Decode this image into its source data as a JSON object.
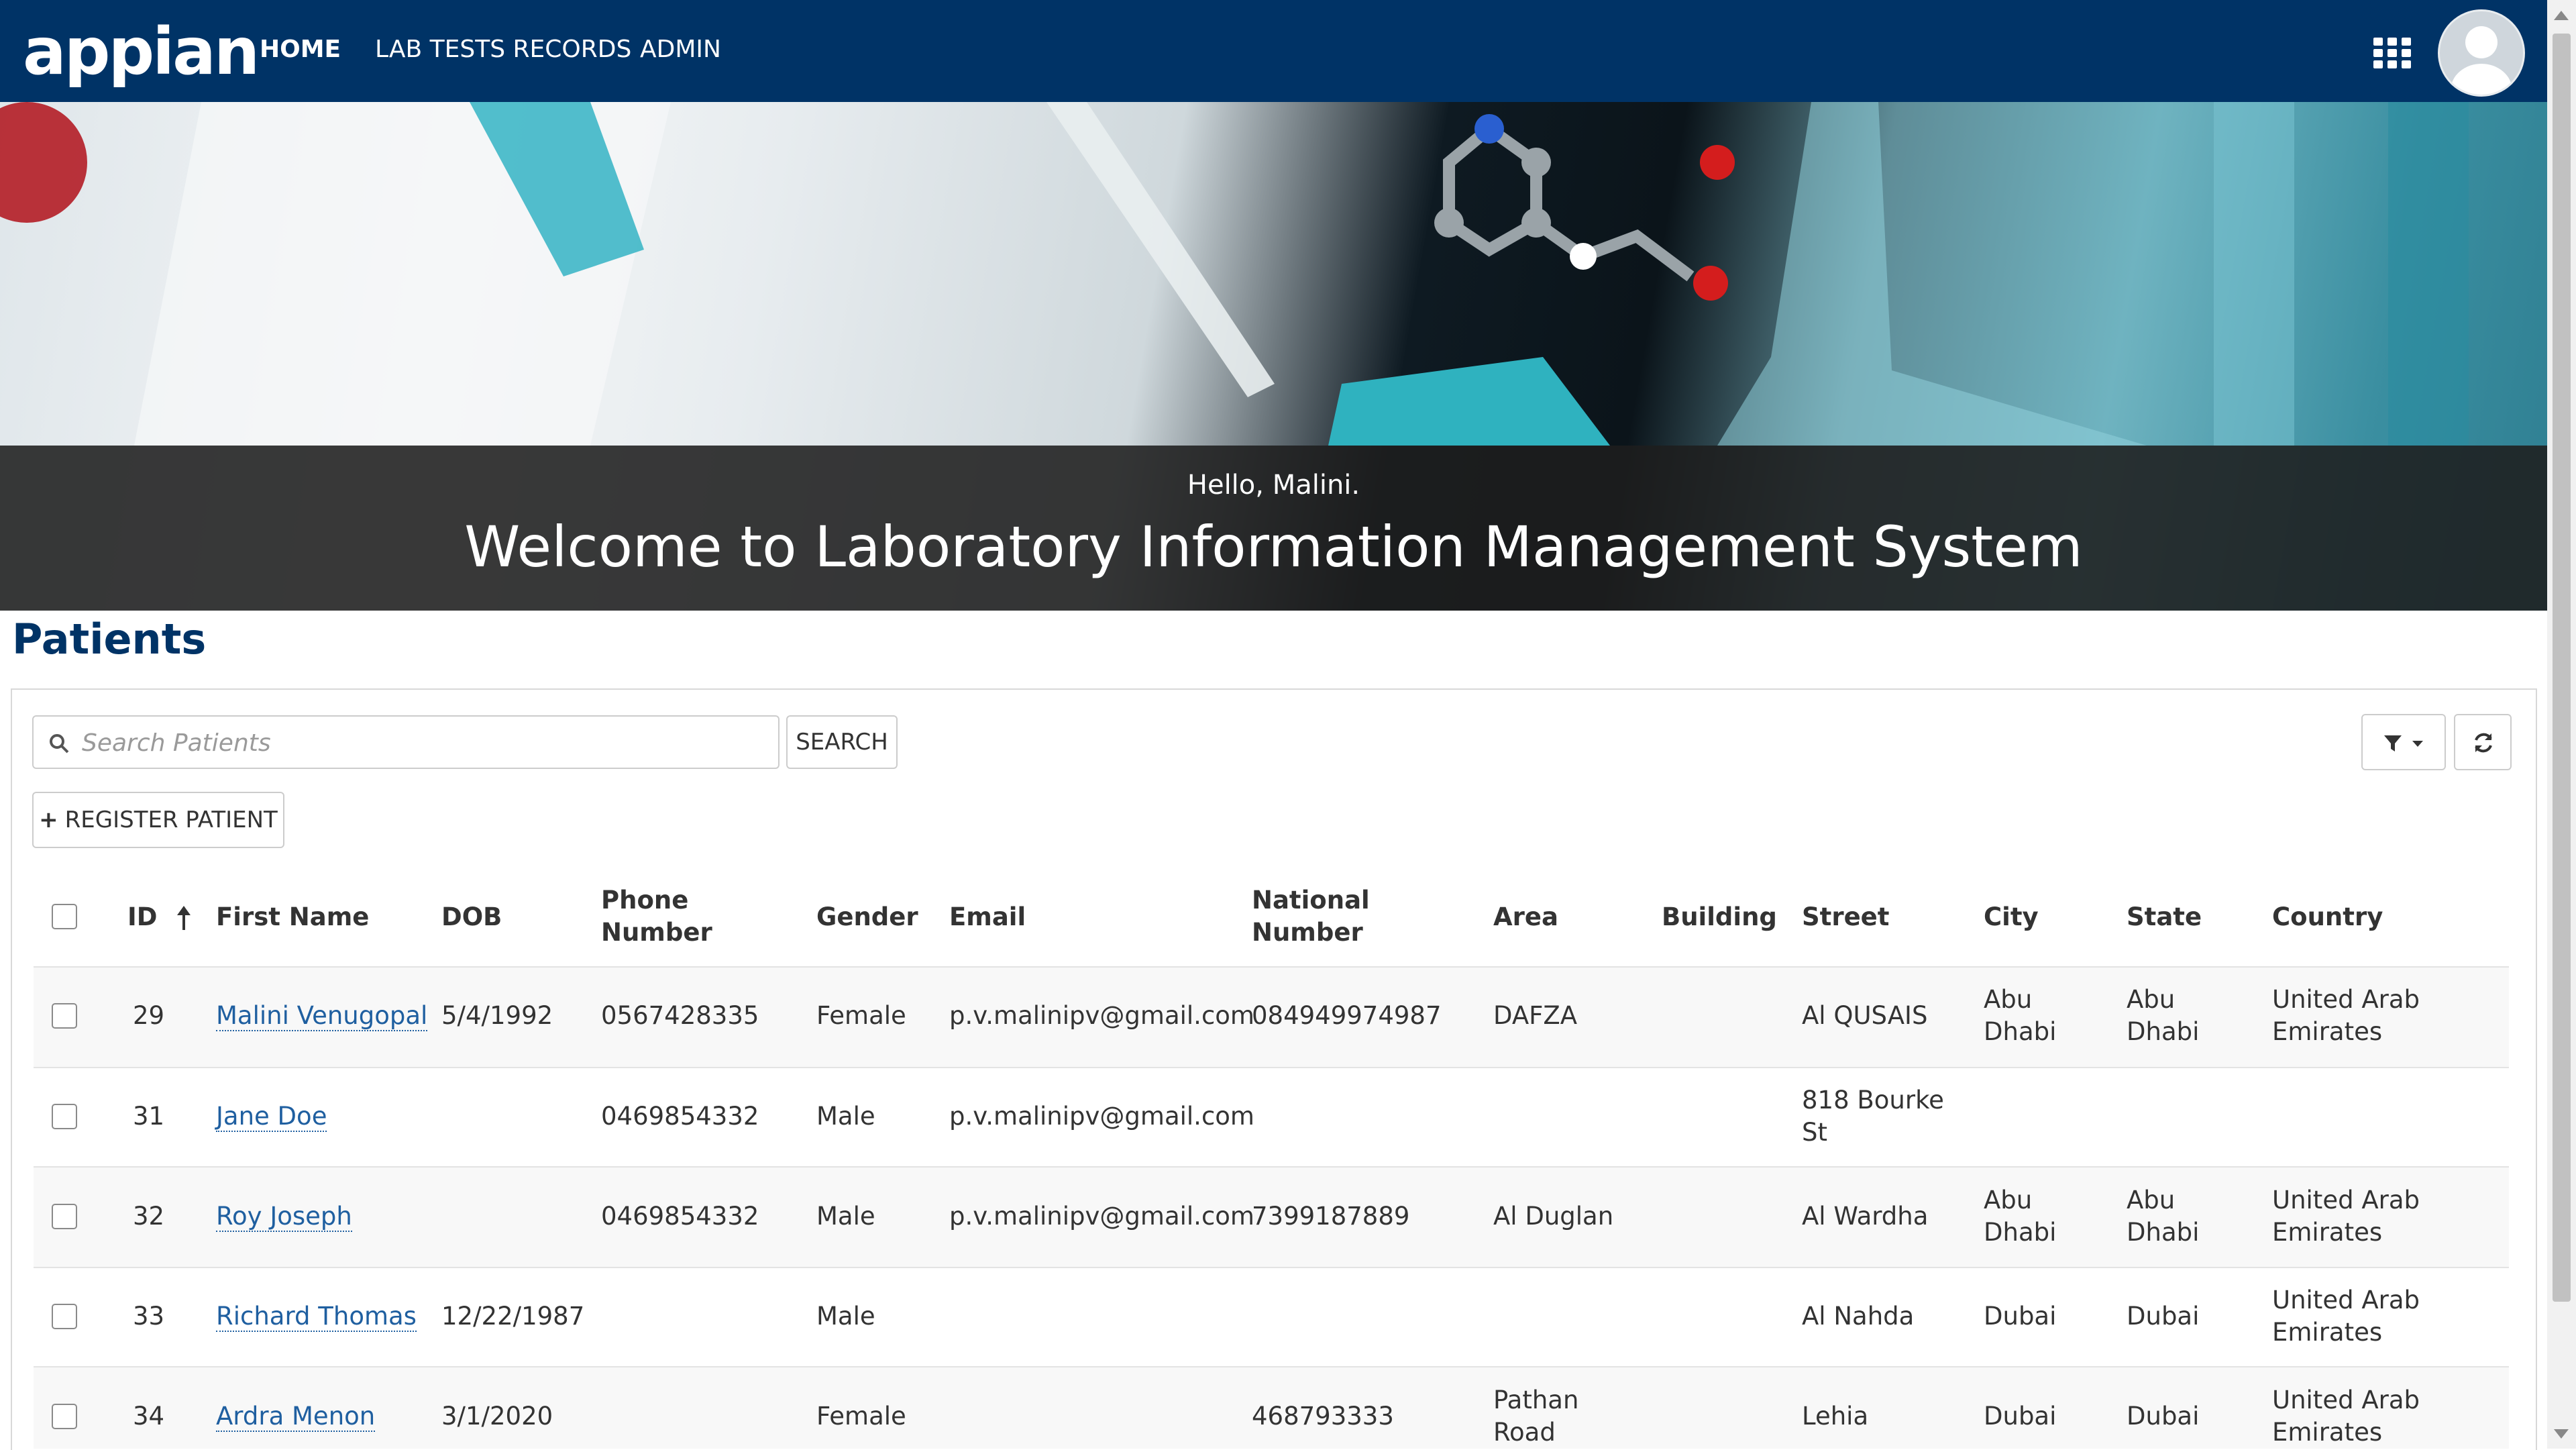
{
  "app": {
    "logo_text": "appian"
  },
  "nav": {
    "items": [
      {
        "label": "HOME",
        "active": true
      },
      {
        "label": "LAB TESTS RECORDS"
      },
      {
        "label": "ADMIN"
      }
    ]
  },
  "banner": {
    "hello": "Hello, Malini.",
    "welcome": "Welcome to Laboratory Information Management System"
  },
  "section": {
    "title": "Patients"
  },
  "search": {
    "placeholder": "Search Patients",
    "button": "SEARCH"
  },
  "actions": {
    "register": "REGISTER PATIENT"
  },
  "table": {
    "columns": {
      "id": "ID",
      "first_name": "First Name",
      "dob": "DOB",
      "phone_l1": "Phone",
      "phone_l2": "Number",
      "gender": "Gender",
      "email": "Email",
      "national_l1": "National",
      "national_l2": "Number",
      "area": "Area",
      "building": "Building",
      "street": "Street",
      "city": "City",
      "state": "State",
      "country": "Country"
    },
    "rows": [
      {
        "id": "29",
        "name": "Malini Venugopal",
        "dob": "5/4/1992",
        "phone": "0567428335",
        "gender": "Female",
        "email": "p.v.malinipv@gmail.com",
        "national": "084949974987",
        "area_l1": "DAFZA",
        "area_l2": "",
        "building": "",
        "street_l1": "Al QUSAIS",
        "street_l2": "",
        "city_l1": "Abu",
        "city_l2": "Dhabi",
        "state_l1": "Abu",
        "state_l2": "Dhabi",
        "country_l1": "United Arab",
        "country_l2": "Emirates"
      },
      {
        "id": "31",
        "name": "Jane Doe",
        "dob": "",
        "phone": "0469854332",
        "gender": "Male",
        "email": "p.v.malinipv@gmail.com",
        "national": "",
        "area_l1": "",
        "area_l2": "",
        "building": "",
        "street_l1": "818 Bourke",
        "street_l2": "St",
        "city_l1": "",
        "city_l2": "",
        "state_l1": "",
        "state_l2": "",
        "country_l1": "",
        "country_l2": ""
      },
      {
        "id": "32",
        "name": "Roy Joseph",
        "dob": "",
        "phone": "0469854332",
        "gender": "Male",
        "email": "p.v.malinipv@gmail.com",
        "national": "7399187889",
        "area_l1": "Al Duglan",
        "area_l2": "",
        "building": "",
        "street_l1": "Al Wardha",
        "street_l2": "",
        "city_l1": "Abu",
        "city_l2": "Dhabi",
        "state_l1": "Abu",
        "state_l2": "Dhabi",
        "country_l1": "United Arab",
        "country_l2": "Emirates"
      },
      {
        "id": "33",
        "name": "Richard Thomas",
        "dob": "12/22/1987",
        "phone": "",
        "gender": "Male",
        "email": "",
        "national": "",
        "area_l1": "",
        "area_l2": "",
        "building": "",
        "street_l1": "Al Nahda",
        "street_l2": "",
        "city_l1": "Dubai",
        "city_l2": "",
        "state_l1": "Dubai",
        "state_l2": "",
        "country_l1": "United Arab",
        "country_l2": "Emirates"
      },
      {
        "id": "34",
        "name": "Ardra Menon",
        "dob": "3/1/2020",
        "phone": "",
        "gender": "Female",
        "email": "",
        "national": "468793333",
        "area_l1": "Pathan",
        "area_l2": "Road",
        "building": "",
        "street_l1": "Lehia",
        "street_l2": "",
        "city_l1": "Dubai",
        "city_l2": "",
        "state_l1": "Dubai",
        "state_l2": "",
        "country_l1": "United Arab",
        "country_l2": "Emirates"
      }
    ]
  },
  "colors": {
    "nav_bg": "#003366",
    "link": "#1f5fa0",
    "title": "#003366"
  },
  "icons": [
    "app-grid-icon",
    "avatar",
    "search-icon",
    "plus-icon",
    "filter-icon",
    "caret-down-icon",
    "refresh-icon",
    "sort-up-icon"
  ]
}
